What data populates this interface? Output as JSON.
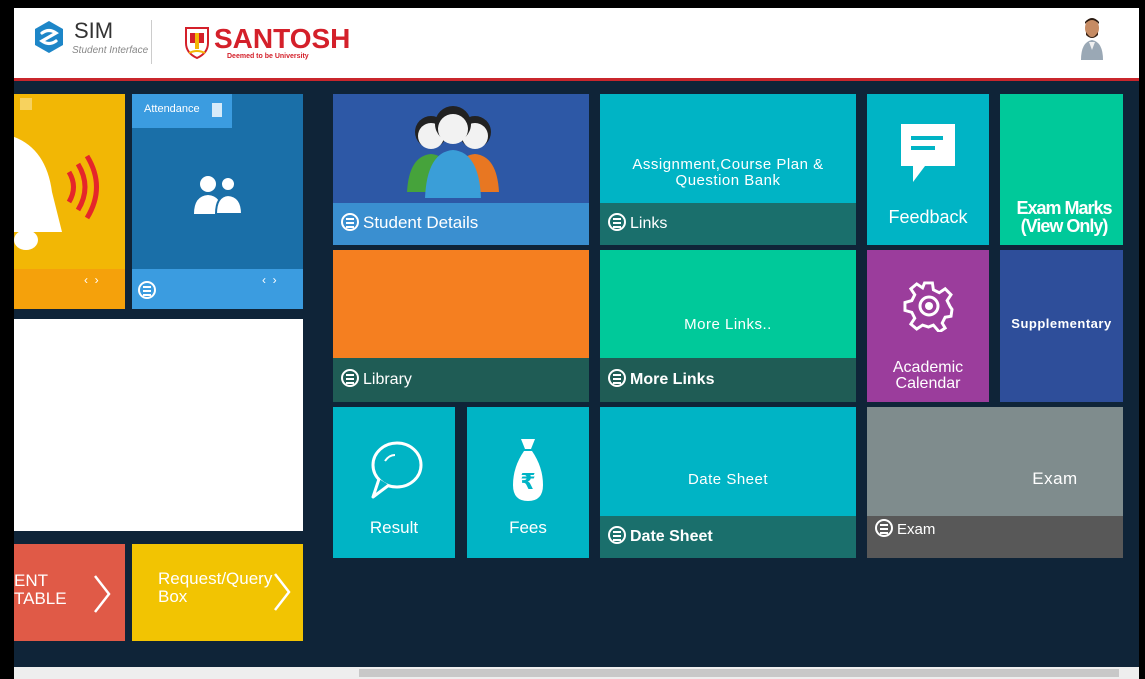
{
  "header": {
    "sim_title": "SIM",
    "sim_subtitle": "Student Interface",
    "university_name": "SANTOSH",
    "university_subtitle": "Deemed to be University"
  },
  "tiles": {
    "attendance_tag": "Attendance",
    "student_details": "Student Details",
    "assignment_title": "Assignment,Course Plan & Question Bank",
    "links": "Links",
    "feedback": "Feedback",
    "exam_marks": "Exam Marks (View Only)",
    "library": "Library",
    "more_links_title": "More Links..",
    "more_links": "More Links",
    "academic_calendar": "Academic Calendar",
    "supplementary": "Supplementary",
    "result": "Result",
    "fees": "Fees",
    "date_sheet_title": "Date Sheet",
    "date_sheet": "Date Sheet",
    "exam_title": "Exam",
    "exam": "Exam",
    "timetable_l1": "ENT",
    "timetable_l2": "TABLE",
    "request_query": "Request/Query Box"
  },
  "colors": {
    "bg": "#0f2438",
    "yellow": "#f2b705",
    "blue": "#1a6fa8",
    "student_blue": "#2d58a6",
    "cyan": "#00b4c5",
    "teal": "#00c0a0",
    "green": "#00c99a",
    "orange": "#f57f20",
    "purple": "#9b3d9c",
    "navy": "#2e4e9a",
    "grey": "#7f8c8d",
    "red": "#e05a47"
  }
}
